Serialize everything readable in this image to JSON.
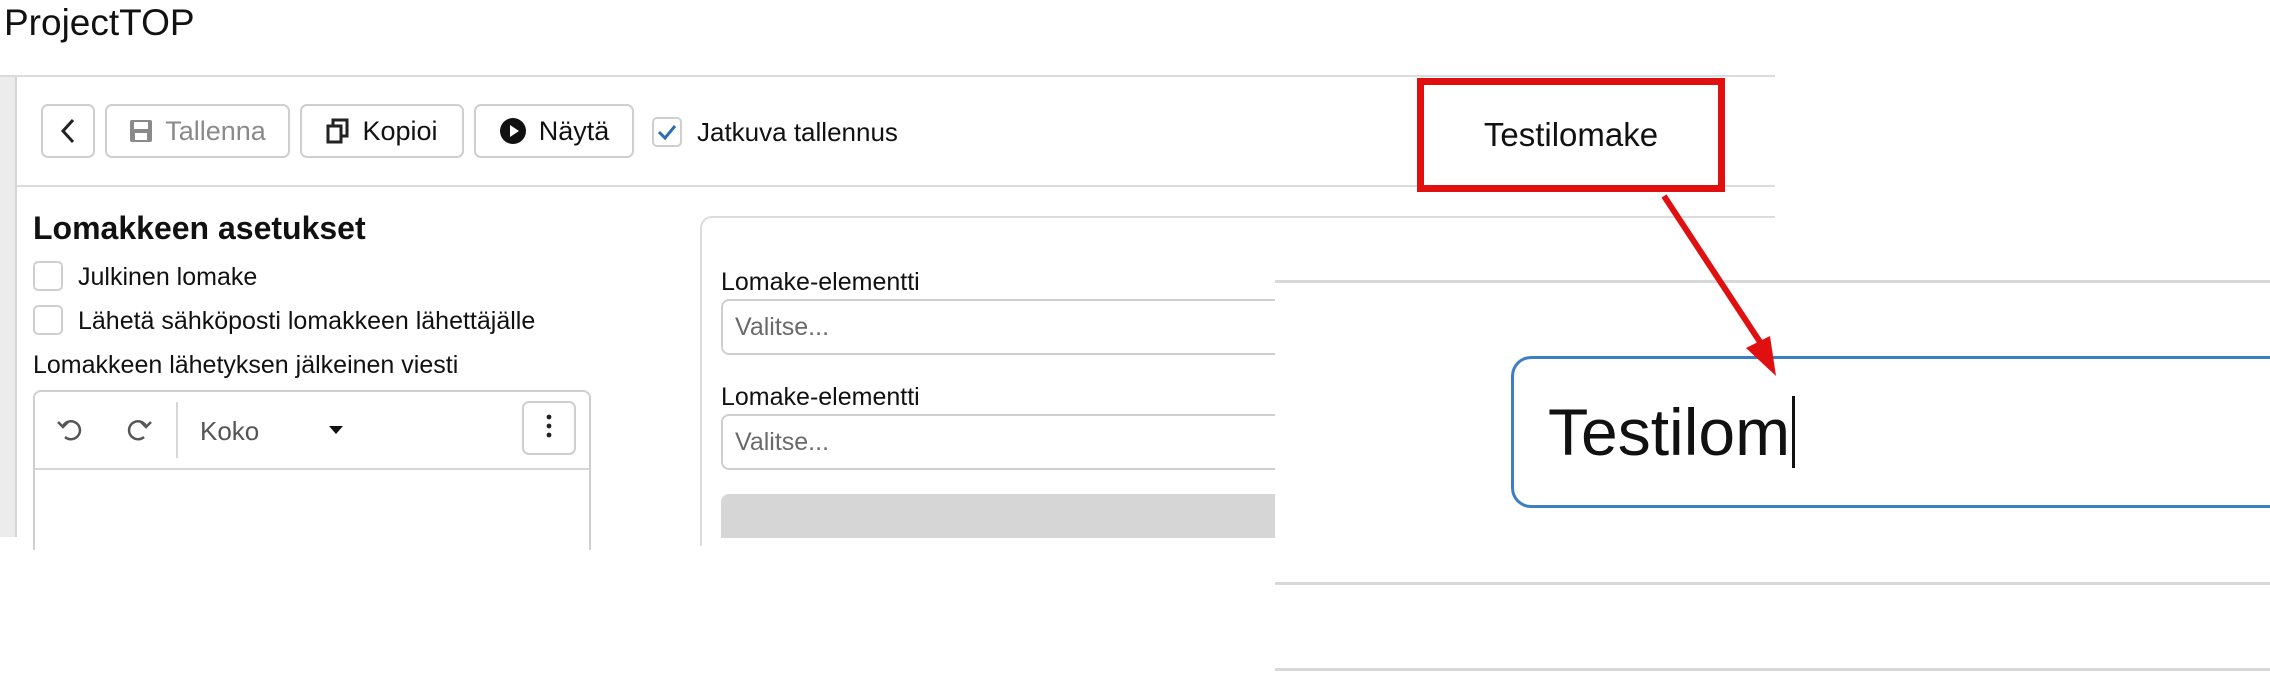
{
  "app": {
    "title": "ProjectTOP"
  },
  "toolbar": {
    "save_label": "Tallenna",
    "copy_label": "Kopioi",
    "show_label": "Näytä",
    "autosave_label": "Jatkuva tallennus",
    "autosave_checked": true
  },
  "form_title_callout": {
    "value": "Testilomake"
  },
  "settings": {
    "heading": "Lomakkeen asetukset",
    "public_form_label": "Julkinen lomake",
    "send_email_label": "Lähetä sähköposti lomakkeen lähettäjälle",
    "post_submit_message_label": "Lomakkeen lähetyksen jälkeinen viesti",
    "editor": {
      "size_select_value": "Koko"
    }
  },
  "form_elements": [
    {
      "label": "Lomake-elementti",
      "placeholder": "Valitse..."
    },
    {
      "label": "Lomake-elementti",
      "placeholder": "Valitse..."
    }
  ],
  "zoom": {
    "input_value": "Testilom"
  },
  "colors": {
    "callout": "#e01010",
    "focus_border": "#3d7fc4",
    "check": "#2b6cb0"
  }
}
